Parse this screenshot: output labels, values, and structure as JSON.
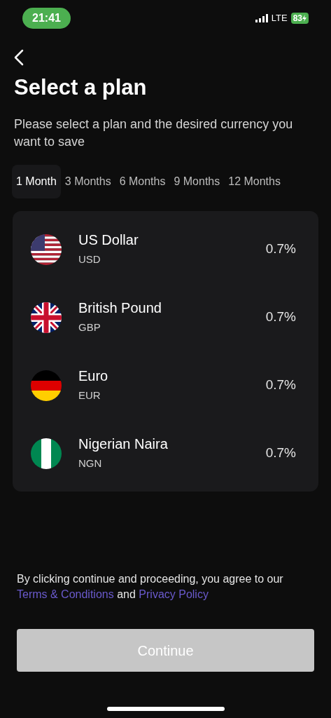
{
  "status_bar": {
    "time": "21:41",
    "network": "LTE",
    "battery": "83"
  },
  "title": "Select a plan",
  "subtitle": "Please select a plan and the desired currency you want to save",
  "tabs": [
    {
      "label": "1 Month",
      "selected": true
    },
    {
      "label": "3 Months",
      "selected": false
    },
    {
      "label": "6 Months",
      "selected": false
    },
    {
      "label": "9 Months",
      "selected": false
    },
    {
      "label": "12 Months",
      "selected": false
    }
  ],
  "currencies": [
    {
      "kind": "usd",
      "name": "US Dollar",
      "code": "USD",
      "rate": "0.7%"
    },
    {
      "kind": "gbp",
      "name": "British Pound",
      "code": "GBP",
      "rate": "0.7%"
    },
    {
      "kind": "eur",
      "name": "Euro",
      "code": "EUR",
      "rate": "0.7%"
    },
    {
      "kind": "ngn",
      "name": "Nigerian Naira",
      "code": "NGN",
      "rate": "0.7%"
    }
  ],
  "legal": {
    "before": "By clicking continue and proceeding, you agree to our",
    "terms_link": "Terms & Conditions",
    "middle": "and",
    "privacy_link": "Privacy Policy"
  },
  "continue_button": {
    "label": "Continue",
    "disabled": true
  }
}
